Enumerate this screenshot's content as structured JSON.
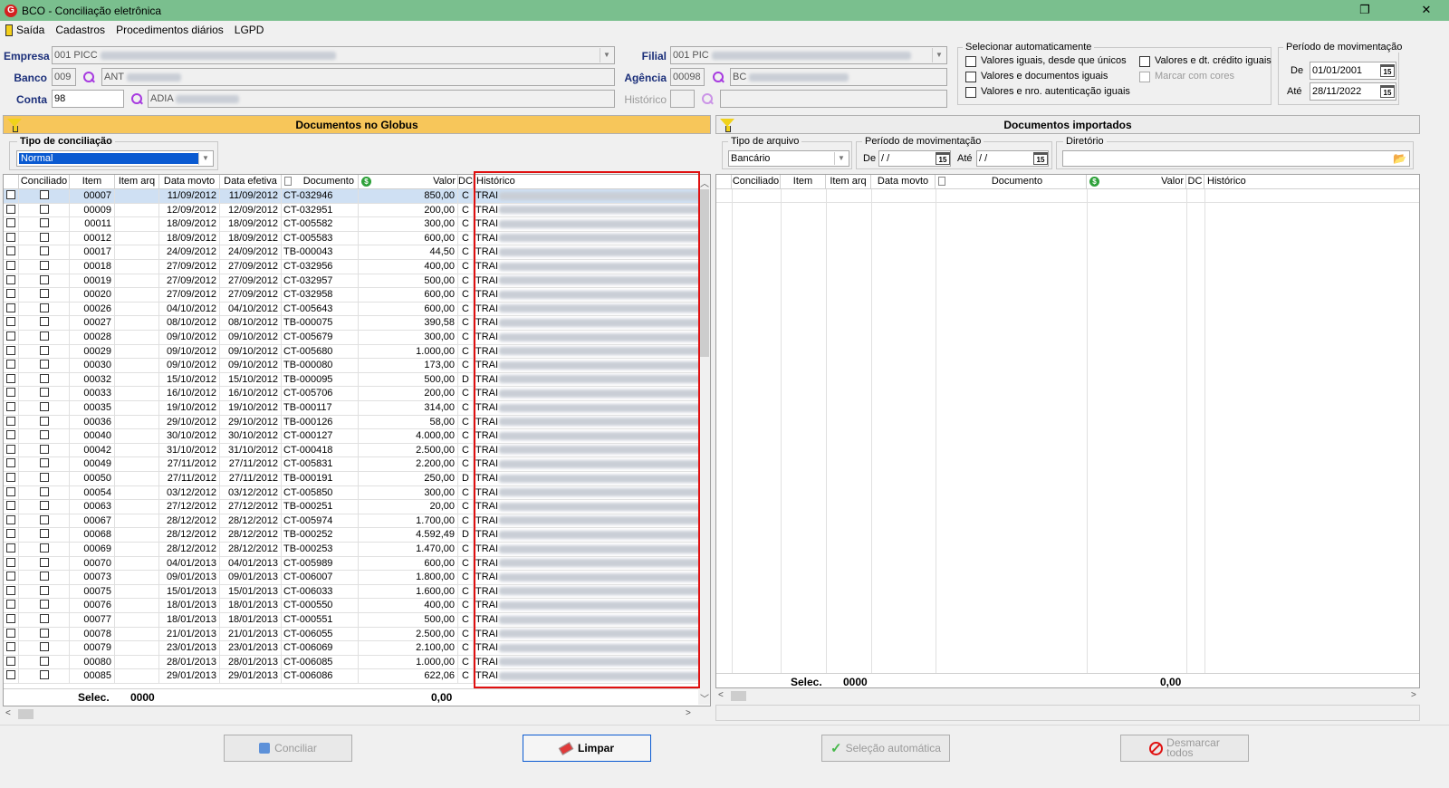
{
  "window": {
    "title": "BCO - Conciliação eletrônica",
    "app_icon": "globus-logo-icon",
    "restore_glyph": "❐",
    "close_glyph": "✕"
  },
  "menu": [
    "Saída",
    "Cadastros",
    "Procedimentos diários",
    "LGPD"
  ],
  "form": {
    "empresa_label": "Empresa",
    "empresa_value": "001 PICC",
    "banco_label": "Banco",
    "banco_code": "009",
    "banco_name": "ANT",
    "conta_label": "Conta",
    "conta_value": "98",
    "conta_name": "ADIA",
    "filial_label": "Filial",
    "filial_value": "001 PIC",
    "agencia_label": "Agência",
    "agencia_code": "00098",
    "agencia_name": "BC",
    "historico_label": "Histórico"
  },
  "auto_select": {
    "title": "Selecionar automaticamente",
    "options": [
      {
        "label": "Valores iguais, desde que únicos",
        "enabled": true
      },
      {
        "label": "Valores e documentos iguais",
        "enabled": true
      },
      {
        "label": "Valores e nro. autenticação iguais",
        "enabled": true
      },
      {
        "label": "Valores e dt. crédito iguais",
        "enabled": true
      },
      {
        "label": "Marcar com cores",
        "enabled": false
      }
    ]
  },
  "period": {
    "title": "Período de movimentação",
    "de_label": "De",
    "de_value": "01/01/2001",
    "ate_label": "Até",
    "ate_value": "28/11/2022",
    "cal_glyph": "15"
  },
  "left_panel": {
    "title": "Documentos no Globus",
    "tipo_label": "Tipo de conciliação",
    "tipo_value": "Normal",
    "columns": [
      "Conciliado",
      "Item",
      "Item arq",
      "Data movto",
      "Data efetiva",
      "Documento",
      "Valor",
      "DC",
      "Histórico"
    ],
    "rows": [
      {
        "item": "00007",
        "dm": "11/09/2012",
        "de": "11/09/2012",
        "doc": "CT-032946",
        "valor": "850,00",
        "dc": "C",
        "hist": "TRAI"
      },
      {
        "item": "00009",
        "dm": "12/09/2012",
        "de": "12/09/2012",
        "doc": "CT-032951",
        "valor": "200,00",
        "dc": "C",
        "hist": "TRAI"
      },
      {
        "item": "00011",
        "dm": "18/09/2012",
        "de": "18/09/2012",
        "doc": "CT-005582",
        "valor": "300,00",
        "dc": "C",
        "hist": "TRAI"
      },
      {
        "item": "00012",
        "dm": "18/09/2012",
        "de": "18/09/2012",
        "doc": "CT-005583",
        "valor": "600,00",
        "dc": "C",
        "hist": "TRAI"
      },
      {
        "item": "00017",
        "dm": "24/09/2012",
        "de": "24/09/2012",
        "doc": "TB-000043",
        "valor": "44,50",
        "dc": "C",
        "hist": "TRAI"
      },
      {
        "item": "00018",
        "dm": "27/09/2012",
        "de": "27/09/2012",
        "doc": "CT-032956",
        "valor": "400,00",
        "dc": "C",
        "hist": "TRAI"
      },
      {
        "item": "00019",
        "dm": "27/09/2012",
        "de": "27/09/2012",
        "doc": "CT-032957",
        "valor": "500,00",
        "dc": "C",
        "hist": "TRAI"
      },
      {
        "item": "00020",
        "dm": "27/09/2012",
        "de": "27/09/2012",
        "doc": "CT-032958",
        "valor": "600,00",
        "dc": "C",
        "hist": "TRAI"
      },
      {
        "item": "00026",
        "dm": "04/10/2012",
        "de": "04/10/2012",
        "doc": "CT-005643",
        "valor": "600,00",
        "dc": "C",
        "hist": "TRAI"
      },
      {
        "item": "00027",
        "dm": "08/10/2012",
        "de": "08/10/2012",
        "doc": "TB-000075",
        "valor": "390,58",
        "dc": "C",
        "hist": "TRAI"
      },
      {
        "item": "00028",
        "dm": "09/10/2012",
        "de": "09/10/2012",
        "doc": "CT-005679",
        "valor": "300,00",
        "dc": "C",
        "hist": "TRAI"
      },
      {
        "item": "00029",
        "dm": "09/10/2012",
        "de": "09/10/2012",
        "doc": "CT-005680",
        "valor": "1.000,00",
        "dc": "C",
        "hist": "TRAI"
      },
      {
        "item": "00030",
        "dm": "09/10/2012",
        "de": "09/10/2012",
        "doc": "TB-000080",
        "valor": "173,00",
        "dc": "C",
        "hist": "TRAI"
      },
      {
        "item": "00032",
        "dm": "15/10/2012",
        "de": "15/10/2012",
        "doc": "TB-000095",
        "valor": "500,00",
        "dc": "D",
        "hist": "TRAI"
      },
      {
        "item": "00033",
        "dm": "16/10/2012",
        "de": "16/10/2012",
        "doc": "CT-005706",
        "valor": "200,00",
        "dc": "C",
        "hist": "TRAI"
      },
      {
        "item": "00035",
        "dm": "19/10/2012",
        "de": "19/10/2012",
        "doc": "TB-000117",
        "valor": "314,00",
        "dc": "C",
        "hist": "TRAI"
      },
      {
        "item": "00036",
        "dm": "29/10/2012",
        "de": "29/10/2012",
        "doc": "TB-000126",
        "valor": "58,00",
        "dc": "C",
        "hist": "TRAI"
      },
      {
        "item": "00040",
        "dm": "30/10/2012",
        "de": "30/10/2012",
        "doc": "CT-000127",
        "valor": "4.000,00",
        "dc": "C",
        "hist": "TRAI"
      },
      {
        "item": "00042",
        "dm": "31/10/2012",
        "de": "31/10/2012",
        "doc": "CT-000418",
        "valor": "2.500,00",
        "dc": "C",
        "hist": "TRAI"
      },
      {
        "item": "00049",
        "dm": "27/11/2012",
        "de": "27/11/2012",
        "doc": "CT-005831",
        "valor": "2.200,00",
        "dc": "C",
        "hist": "TRAI"
      },
      {
        "item": "00050",
        "dm": "27/11/2012",
        "de": "27/11/2012",
        "doc": "TB-000191",
        "valor": "250,00",
        "dc": "D",
        "hist": "TRAI"
      },
      {
        "item": "00054",
        "dm": "03/12/2012",
        "de": "03/12/2012",
        "doc": "CT-005850",
        "valor": "300,00",
        "dc": "C",
        "hist": "TRAI"
      },
      {
        "item": "00063",
        "dm": "27/12/2012",
        "de": "27/12/2012",
        "doc": "TB-000251",
        "valor": "20,00",
        "dc": "C",
        "hist": "TRAI"
      },
      {
        "item": "00067",
        "dm": "28/12/2012",
        "de": "28/12/2012",
        "doc": "CT-005974",
        "valor": "1.700,00",
        "dc": "C",
        "hist": "TRAI"
      },
      {
        "item": "00068",
        "dm": "28/12/2012",
        "de": "28/12/2012",
        "doc": "TB-000252",
        "valor": "4.592,49",
        "dc": "D",
        "hist": "TRAI"
      },
      {
        "item": "00069",
        "dm": "28/12/2012",
        "de": "28/12/2012",
        "doc": "TB-000253",
        "valor": "1.470,00",
        "dc": "C",
        "hist": "TRAI"
      },
      {
        "item": "00070",
        "dm": "04/01/2013",
        "de": "04/01/2013",
        "doc": "CT-005989",
        "valor": "600,00",
        "dc": "C",
        "hist": "TRAI"
      },
      {
        "item": "00073",
        "dm": "09/01/2013",
        "de": "09/01/2013",
        "doc": "CT-006007",
        "valor": "1.800,00",
        "dc": "C",
        "hist": "TRAI"
      },
      {
        "item": "00075",
        "dm": "15/01/2013",
        "de": "15/01/2013",
        "doc": "CT-006033",
        "valor": "1.600,00",
        "dc": "C",
        "hist": "TRAI"
      },
      {
        "item": "00076",
        "dm": "18/01/2013",
        "de": "18/01/2013",
        "doc": "CT-000550",
        "valor": "400,00",
        "dc": "C",
        "hist": "TRAI"
      },
      {
        "item": "00077",
        "dm": "18/01/2013",
        "de": "18/01/2013",
        "doc": "CT-000551",
        "valor": "500,00",
        "dc": "C",
        "hist": "TRAI"
      },
      {
        "item": "00078",
        "dm": "21/01/2013",
        "de": "21/01/2013",
        "doc": "CT-006055",
        "valor": "2.500,00",
        "dc": "C",
        "hist": "TRAI"
      },
      {
        "item": "00079",
        "dm": "23/01/2013",
        "de": "23/01/2013",
        "doc": "CT-006069",
        "valor": "2.100,00",
        "dc": "C",
        "hist": "TRAI"
      },
      {
        "item": "00080",
        "dm": "28/01/2013",
        "de": "28/01/2013",
        "doc": "CT-006085",
        "valor": "1.000,00",
        "dc": "C",
        "hist": "TRAI"
      },
      {
        "item": "00085",
        "dm": "29/01/2013",
        "de": "29/01/2013",
        "doc": "CT-006086",
        "valor": "622,06",
        "dc": "C",
        "hist": "TRAI"
      }
    ],
    "footer": {
      "selec_label": "Selec.",
      "selec_count": "0000",
      "total": "0,00"
    }
  },
  "right_panel": {
    "title": "Documentos importados",
    "tipo_arquivo_label": "Tipo de arquivo",
    "tipo_arquivo_value": "Bancário",
    "periodo_label": "Período de movimentação",
    "de_label": "De",
    "de_value": " /  /",
    "ate_label": "Até",
    "ate_value": " /  /",
    "diretorio_label": "Diretório",
    "columns": [
      "Conciliado",
      "Item",
      "Item arq",
      "Data movto",
      "Documento",
      "Valor",
      "DC",
      "Histórico"
    ],
    "footer": {
      "selec_label": "Selec.",
      "selec_count": "0000",
      "total": "0,00"
    }
  },
  "buttons": {
    "conciliar": "Conciliar",
    "limpar": "Limpar",
    "selecao": "Seleção automática",
    "desmarcar_line1": "Desmarcar",
    "desmarcar_line2": "todos"
  },
  "colors": {
    "titlebar": "#7abf8e",
    "panel_header_left": "#f7c65a",
    "selected_row": "#cfe0f3",
    "highlight_box": "#e01010"
  }
}
